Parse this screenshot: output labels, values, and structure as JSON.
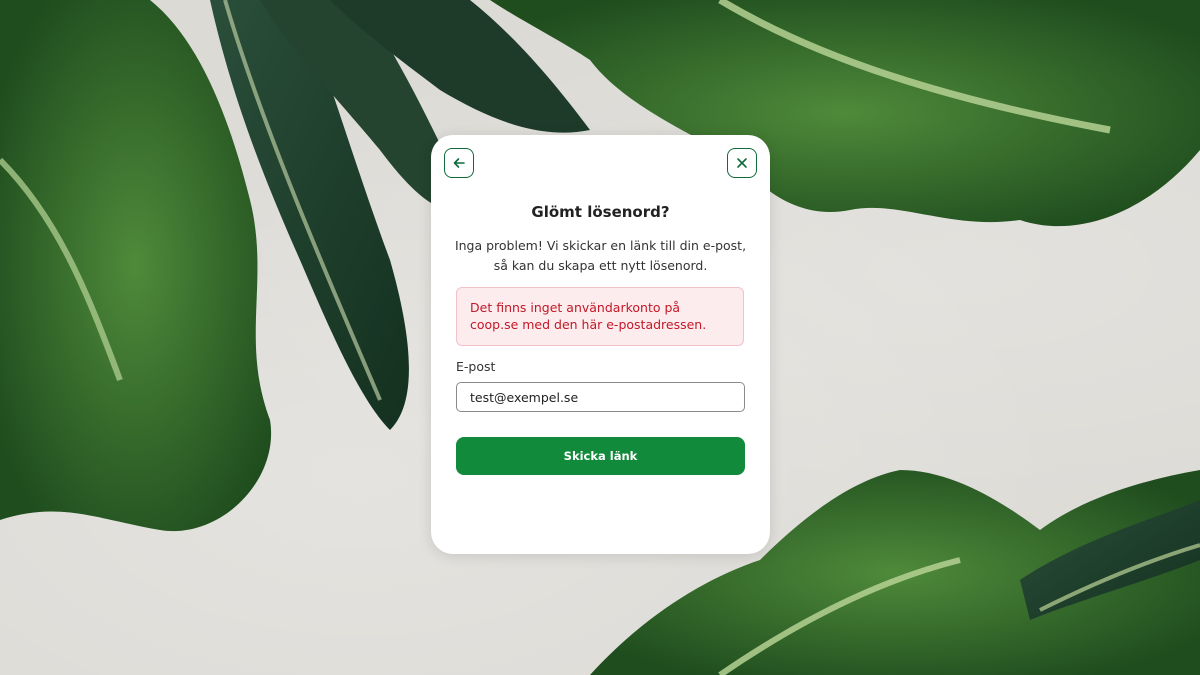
{
  "dialog": {
    "title": "Glömt lösenord?",
    "description": "Inga problem! Vi skickar en länk till din e-post, så kan du skapa ett nytt lösenord.",
    "error_message": "Det finns inget användarkonto på coop.se med den här e-postadressen.",
    "email_label": "E-post",
    "email_value": "test@exempel.se",
    "submit_label": "Skicka länk",
    "back_icon": "arrow-left-icon",
    "close_icon": "close-icon"
  },
  "colors": {
    "brand_green": "#128a3b",
    "icon_green": "#0f6b3a",
    "error_text": "#c21827",
    "error_bg": "#fdecee",
    "background": "#dcdad5"
  }
}
